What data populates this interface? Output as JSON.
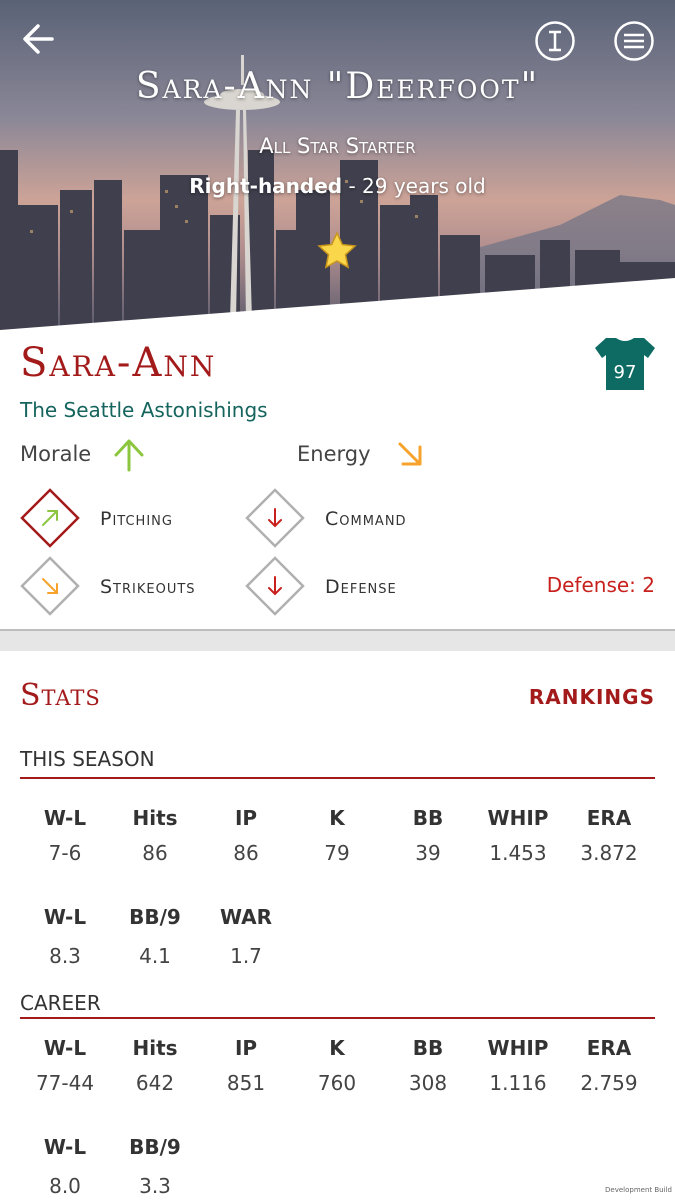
{
  "hero": {
    "name": "Sara-Ann \"Deerfoot\"",
    "role": "All Star Starter",
    "handedness": "Right-handed",
    "age_text": " - 29 years old"
  },
  "player": {
    "first_name": "Sara-Ann",
    "team": "The Seattle Astonishings",
    "jersey_number": "97",
    "jersey_color": "#0d6b63",
    "morale_label": "Morale",
    "morale_trend": "up",
    "energy_label": "Energy",
    "energy_trend": "down-right"
  },
  "skills": [
    {
      "label": "Pitching",
      "trend": "up-right",
      "color": "#8cc63f"
    },
    {
      "label": "Command",
      "trend": "down",
      "color": "#c8201d"
    },
    {
      "label": "Strikeouts",
      "trend": "down-right",
      "color": "#f7a22b"
    },
    {
      "label": "Defense",
      "trend": "down",
      "color": "#c8201d"
    }
  ],
  "defense_note": "Defense: 2",
  "stats": {
    "title": "Stats",
    "rankings_label": "RANKINGS",
    "this_season": {
      "label": "THIS SEASON",
      "row1_headers": [
        "W-L",
        "Hits",
        "IP",
        "K",
        "BB",
        "WHIP",
        "ERA"
      ],
      "row1_values": [
        "7-6",
        "86",
        "86",
        "79",
        "39",
        "1.453",
        "3.872"
      ],
      "row2_headers": [
        "W-L",
        "BB/9",
        "WAR"
      ],
      "row2_values": [
        "8.3",
        "4.1",
        "1.7"
      ]
    },
    "career": {
      "label": "CAREER",
      "row1_headers": [
        "W-L",
        "Hits",
        "IP",
        "K",
        "BB",
        "WHIP",
        "ERA"
      ],
      "row1_values": [
        "77-44",
        "642",
        "851",
        "760",
        "308",
        "1.116",
        "2.759"
      ],
      "row2_headers": [
        "W-L",
        "BB/9"
      ],
      "row2_values": [
        "8.0",
        "3.3"
      ]
    }
  },
  "watermark": "Development Build",
  "colors": {
    "accent": "#a31a1a",
    "team": "#15655e",
    "up": "#8cc63f",
    "warn": "#f7a22b",
    "down": "#c8201d"
  }
}
